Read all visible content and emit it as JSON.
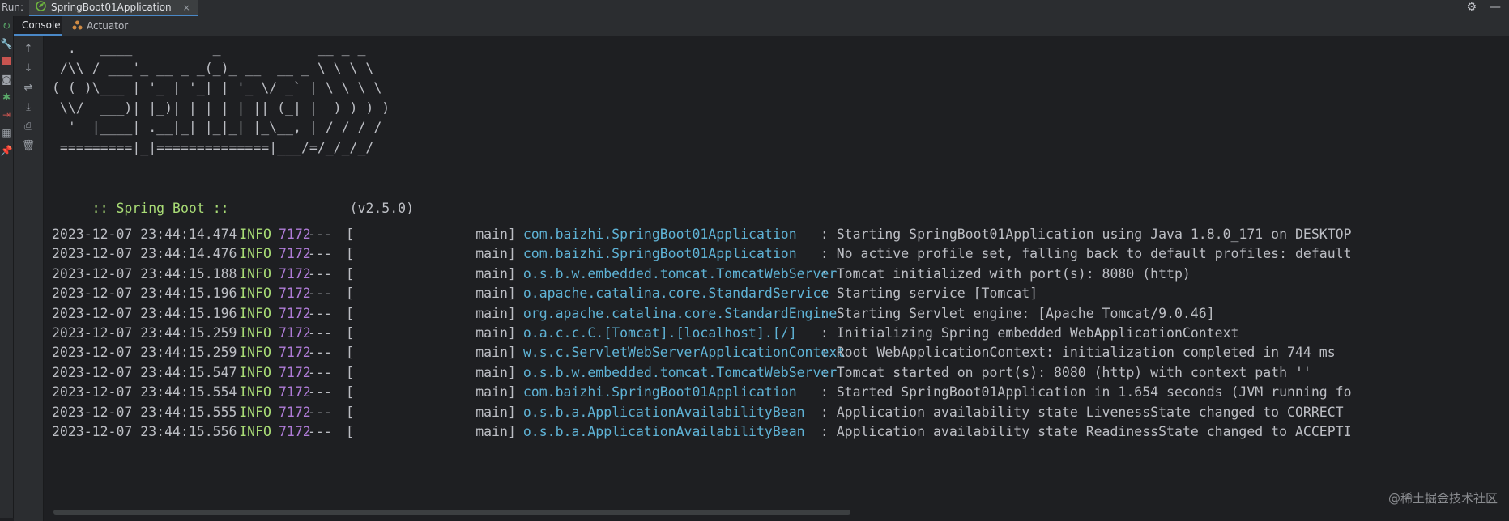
{
  "run_bar": {
    "label": "Run:",
    "tab_title": "SpringBoot01Application",
    "tab_close": "×"
  },
  "subtabs": {
    "console": "Console",
    "actuator": "Actuator"
  },
  "banner_ascii": "  .   ____          _            __ _ _\n /\\\\ / ___'_ __ _ _(_)_ __  __ _ \\ \\ \\ \\\n( ( )\\___ | '_ | '_| | '_ \\/ _` | \\ \\ \\ \\\n \\\\/  ___)| |_)| | | | | || (_| |  ) ) ) )\n  '  |____| .__|_| |_|_| |_\\__, | / / / /\n =========|_|==============|___/=/_/_/_/",
  "spring_boot": {
    "label": " :: Spring Boot :: ",
    "version": "              (v2.5.0)"
  },
  "logs": [
    {
      "ts": "2023-12-07 23:44:14.474",
      "level": "INFO",
      "pid": "7172",
      "sep": "---",
      "br_open": "[",
      "thread": "main",
      "br_close": "]",
      "logger": "com.baizhi.SpringBoot01Application",
      "msg": ": Starting SpringBoot01Application using Java 1.8.0_171 on DESKTOP"
    },
    {
      "ts": "2023-12-07 23:44:14.476",
      "level": "INFO",
      "pid": "7172",
      "sep": "---",
      "br_open": "[",
      "thread": "main",
      "br_close": "]",
      "logger": "com.baizhi.SpringBoot01Application",
      "msg": ": No active profile set, falling back to default profiles: default"
    },
    {
      "ts": "2023-12-07 23:44:15.188",
      "level": "INFO",
      "pid": "7172",
      "sep": "---",
      "br_open": "[",
      "thread": "main",
      "br_close": "]",
      "logger": "o.s.b.w.embedded.tomcat.TomcatWebServer",
      "msg": ": Tomcat initialized with port(s): 8080 (http)"
    },
    {
      "ts": "2023-12-07 23:44:15.196",
      "level": "INFO",
      "pid": "7172",
      "sep": "---",
      "br_open": "[",
      "thread": "main",
      "br_close": "]",
      "logger": "o.apache.catalina.core.StandardService",
      "msg": ": Starting service [Tomcat]"
    },
    {
      "ts": "2023-12-07 23:44:15.196",
      "level": "INFO",
      "pid": "7172",
      "sep": "---",
      "br_open": "[",
      "thread": "main",
      "br_close": "]",
      "logger": "org.apache.catalina.core.StandardEngine",
      "msg": ": Starting Servlet engine: [Apache Tomcat/9.0.46]"
    },
    {
      "ts": "2023-12-07 23:44:15.259",
      "level": "INFO",
      "pid": "7172",
      "sep": "---",
      "br_open": "[",
      "thread": "main",
      "br_close": "]",
      "logger": "o.a.c.c.C.[Tomcat].[localhost].[/]",
      "msg": ": Initializing Spring embedded WebApplicationContext"
    },
    {
      "ts": "2023-12-07 23:44:15.259",
      "level": "INFO",
      "pid": "7172",
      "sep": "---",
      "br_open": "[",
      "thread": "main",
      "br_close": "]",
      "logger": "w.s.c.ServletWebServerApplicationContext",
      "msg": ": Root WebApplicationContext: initialization completed in 744 ms"
    },
    {
      "ts": "2023-12-07 23:44:15.547",
      "level": "INFO",
      "pid": "7172",
      "sep": "---",
      "br_open": "[",
      "thread": "main",
      "br_close": "]",
      "logger": "o.s.b.w.embedded.tomcat.TomcatWebServer",
      "msg": ": Tomcat started on port(s): 8080 (http) with context path ''"
    },
    {
      "ts": "2023-12-07 23:44:15.554",
      "level": "INFO",
      "pid": "7172",
      "sep": "---",
      "br_open": "[",
      "thread": "main",
      "br_close": "]",
      "logger": "com.baizhi.SpringBoot01Application",
      "msg": ": Started SpringBoot01Application in 1.654 seconds (JVM running fo"
    },
    {
      "ts": "2023-12-07 23:44:15.555",
      "level": "INFO",
      "pid": "7172",
      "sep": "---",
      "br_open": "[",
      "thread": "main",
      "br_close": "]",
      "logger": "o.s.b.a.ApplicationAvailabilityBean",
      "msg": ": Application availability state LivenessState changed to CORRECT"
    },
    {
      "ts": "2023-12-07 23:44:15.556",
      "level": "INFO",
      "pid": "7172",
      "sep": "---",
      "br_open": "[",
      "thread": "main",
      "br_close": "]",
      "logger": "o.s.b.a.ApplicationAvailabilityBean",
      "msg": ": Application availability state ReadinessState changed to ACCEPTI"
    }
  ],
  "watermark": "@稀土掘金技术社区",
  "colors": {
    "background": "#1e1f22",
    "info": "#a9dc76",
    "pid": "#b07cd8",
    "logger": "#5fb3d6",
    "text": "#bcbec4"
  },
  "icons": {
    "spring_app": "spring-leaf-icon",
    "settings": "gear-icon",
    "hide": "minimize-icon"
  }
}
